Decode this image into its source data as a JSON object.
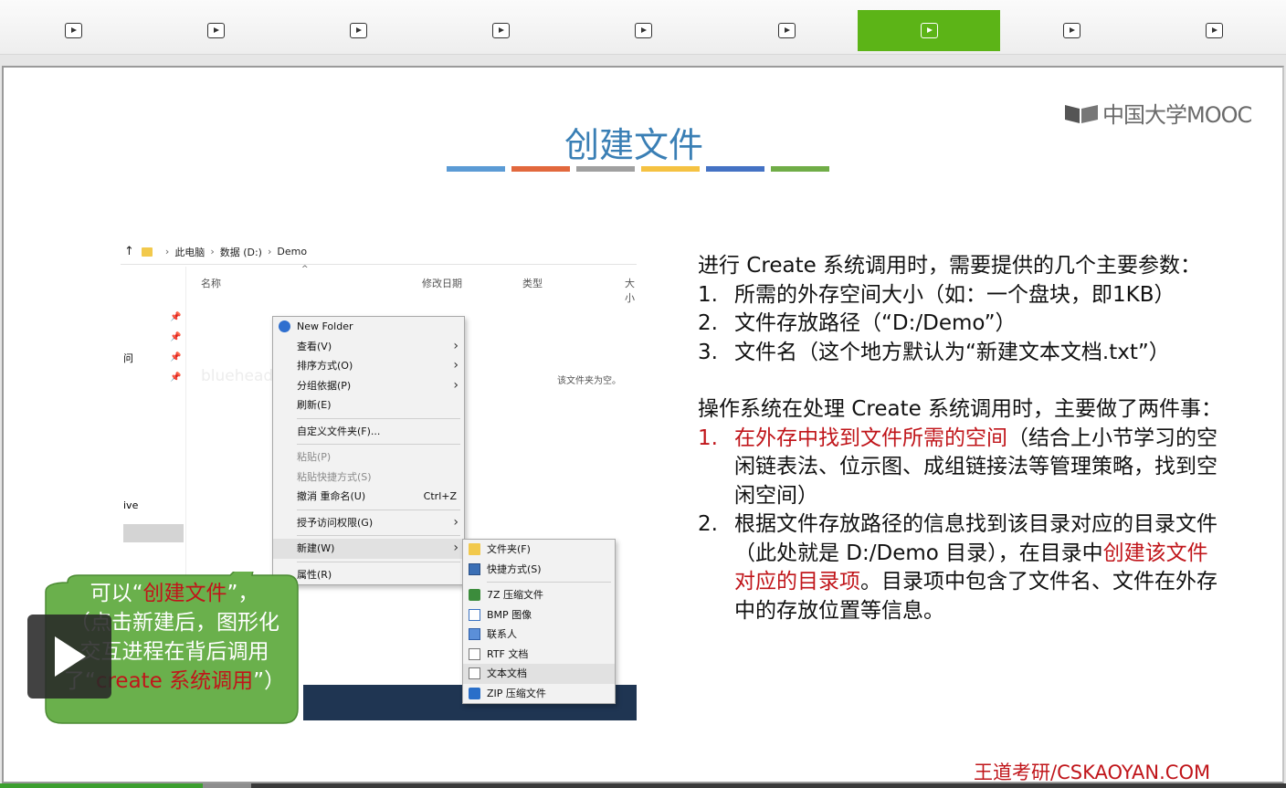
{
  "tabs": [
    {
      "icon": "play-icon",
      "active": false
    },
    {
      "icon": "play-icon",
      "active": false
    },
    {
      "icon": "play-icon",
      "active": false
    },
    {
      "icon": "play-icon",
      "active": false
    },
    {
      "icon": "play-icon",
      "active": false
    },
    {
      "icon": "play-icon",
      "active": false
    },
    {
      "icon": "play-icon",
      "active": true
    },
    {
      "icon": "play-icon",
      "active": false
    },
    {
      "icon": "play-icon",
      "active": false
    }
  ],
  "slide": {
    "logo": "中国大学MOOC",
    "title": "创建文件",
    "title_bar_colors": [
      "#5b9bd5",
      "#e2683d",
      "#a0a0a0",
      "#f5c242",
      "#4472c4",
      "#70ad47"
    ],
    "footer": "王道考研/CSKAOYAN.COM"
  },
  "explorer": {
    "breadcrumb": [
      "此电脑",
      "数据 (D:)",
      "Demo"
    ],
    "columns": [
      "名称",
      "修改日期",
      "类型",
      "大小"
    ],
    "empty_text": "该文件夹为空。",
    "ghost_text": "bluehead2019",
    "left_fragments": [
      "问",
      "ive"
    ],
    "context_menu": [
      {
        "label": "New Folder",
        "icon": "new-folder-icon"
      },
      {
        "label": "查看(V)",
        "submenu": true
      },
      {
        "label": "排序方式(O)",
        "submenu": true
      },
      {
        "label": "分组依据(P)",
        "submenu": true
      },
      {
        "label": "刷新(E)"
      },
      {
        "sep": true
      },
      {
        "label": "自定义文件夹(F)..."
      },
      {
        "sep": true
      },
      {
        "label": "粘贴(P)",
        "disabled": true
      },
      {
        "label": "粘贴快捷方式(S)",
        "disabled": true
      },
      {
        "label": "撤消 重命名(U)",
        "shortcut": "Ctrl+Z"
      },
      {
        "sep": true
      },
      {
        "label": "授予访问权限(G)",
        "submenu": true
      },
      {
        "sep": true
      },
      {
        "label": "新建(W)",
        "submenu": true,
        "highlighted": true
      },
      {
        "sep": true
      },
      {
        "label": "属性(R)"
      }
    ],
    "new_submenu": [
      {
        "label": "文件夹(F)",
        "icon": "folder-icon"
      },
      {
        "label": "快捷方式(S)",
        "icon": "shortcut-icon"
      },
      {
        "sep": true
      },
      {
        "label": "7Z 压缩文件",
        "icon": "7z-archive-icon"
      },
      {
        "label": "BMP 图像",
        "icon": "bmp-image-icon"
      },
      {
        "label": "联系人",
        "icon": "contact-icon"
      },
      {
        "label": "RTF 文档",
        "icon": "rtf-document-icon"
      },
      {
        "label": "文本文档",
        "icon": "text-document-icon",
        "highlighted": true
      },
      {
        "label": "ZIP 压缩文件",
        "icon": "zip-archive-icon"
      }
    ]
  },
  "callout": {
    "l1a": "可以“",
    "l1b": "创建文件",
    "l1c": "”，",
    "l2": "（点击新建后，图形化交互进程在背后调用了“",
    "l3": "create 系统调用",
    "l4": "”）"
  },
  "right": {
    "intro": "进行 Create 系统调用时，需要提供的几个主要参数：",
    "params": [
      {
        "n": "1.",
        "t": "所需的外存空间大小（如：一个盘块，即1KB）"
      },
      {
        "n": "2.",
        "t": "文件存放路径（“D:/Demo”）"
      },
      {
        "n": "3.",
        "t": "文件名（这个地方默认为“新建文本文档.txt”）"
      }
    ],
    "intro2": "操作系统在处理 Create 系统调用时，主要做了两件事：",
    "step1_n": "1.",
    "step1_red": "在外存中找到文件所需的空间",
    "step1_rest": "（结合上小节学习的空闲链表法、位示图、成组链接法等管理策略，找到空闲空间）",
    "step2_n": "2.",
    "step2_a": "根据文件存放路径的信息找到该目录对应的目录文件（此处就是 D:/Demo 目录），在目录中",
    "step2_red": "创建该文件对应的目录项",
    "step2_b": "。目录项中包含了文件名、文件在外存中的存放位置等信息。"
  },
  "video": {
    "played_fraction": 0.158,
    "buffered_fraction": 0.195
  }
}
